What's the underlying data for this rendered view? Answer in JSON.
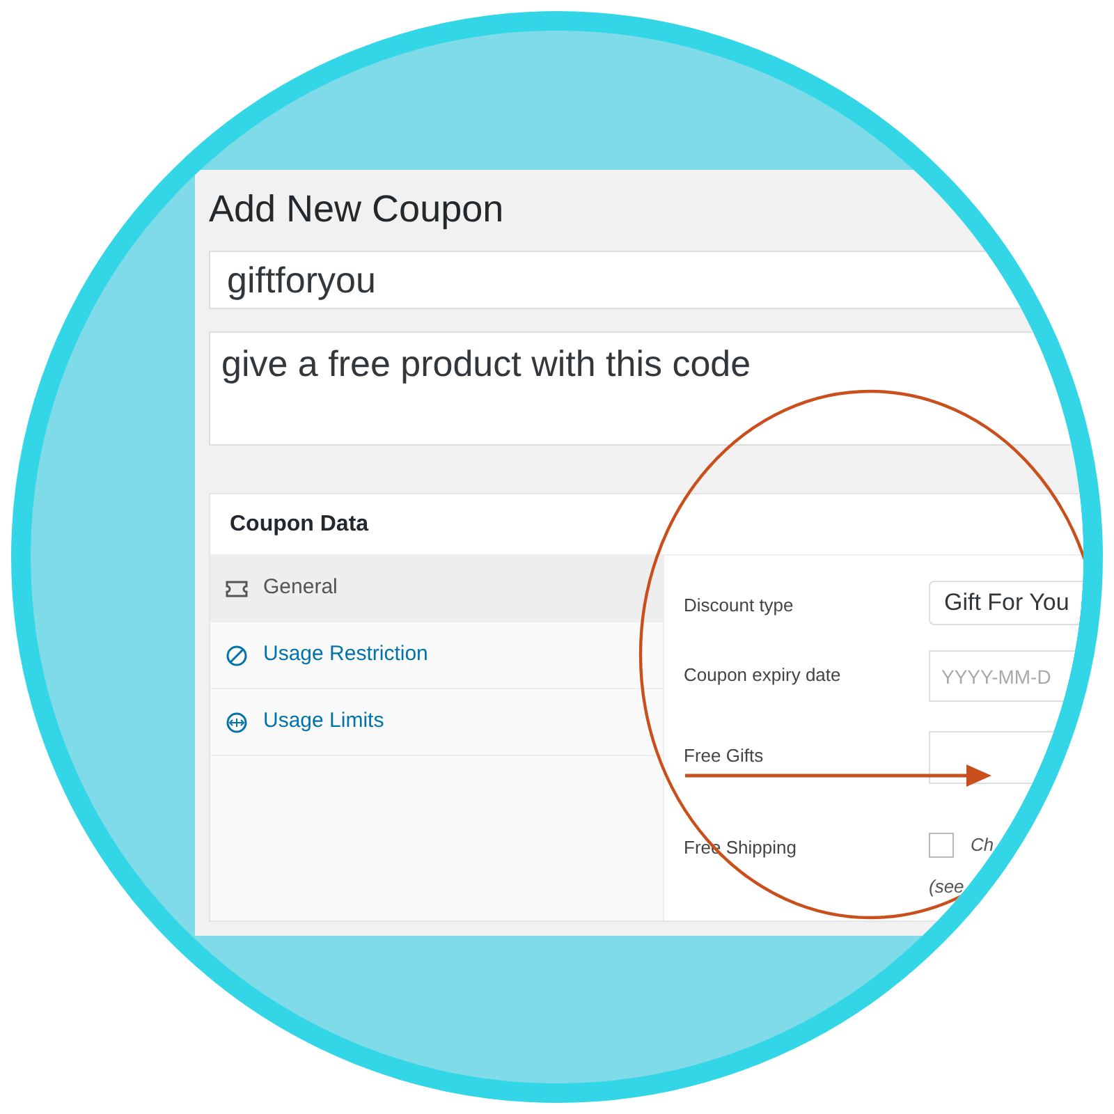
{
  "page": {
    "title": "Add New Coupon"
  },
  "coupon_code": {
    "value": "giftforyou"
  },
  "description": {
    "value": "give a free product with this code"
  },
  "coupon_data": {
    "title": "Coupon Data",
    "tabs": [
      {
        "label": "General",
        "selected": true
      },
      {
        "label": "Usage Restriction",
        "selected": false
      },
      {
        "label": "Usage Limits",
        "selected": false
      }
    ],
    "fields": [
      {
        "kind": "select",
        "label": "Discount type",
        "value": "Gift For You"
      },
      {
        "kind": "date",
        "label": "Coupon expiry date",
        "placeholder": "YYYY-MM-D"
      },
      {
        "kind": "text",
        "label": "Free Gifts"
      },
      {
        "kind": "checkbox",
        "label": "Free Shipping",
        "checked": false,
        "text": "Ch",
        "note": "(see"
      }
    ]
  }
}
